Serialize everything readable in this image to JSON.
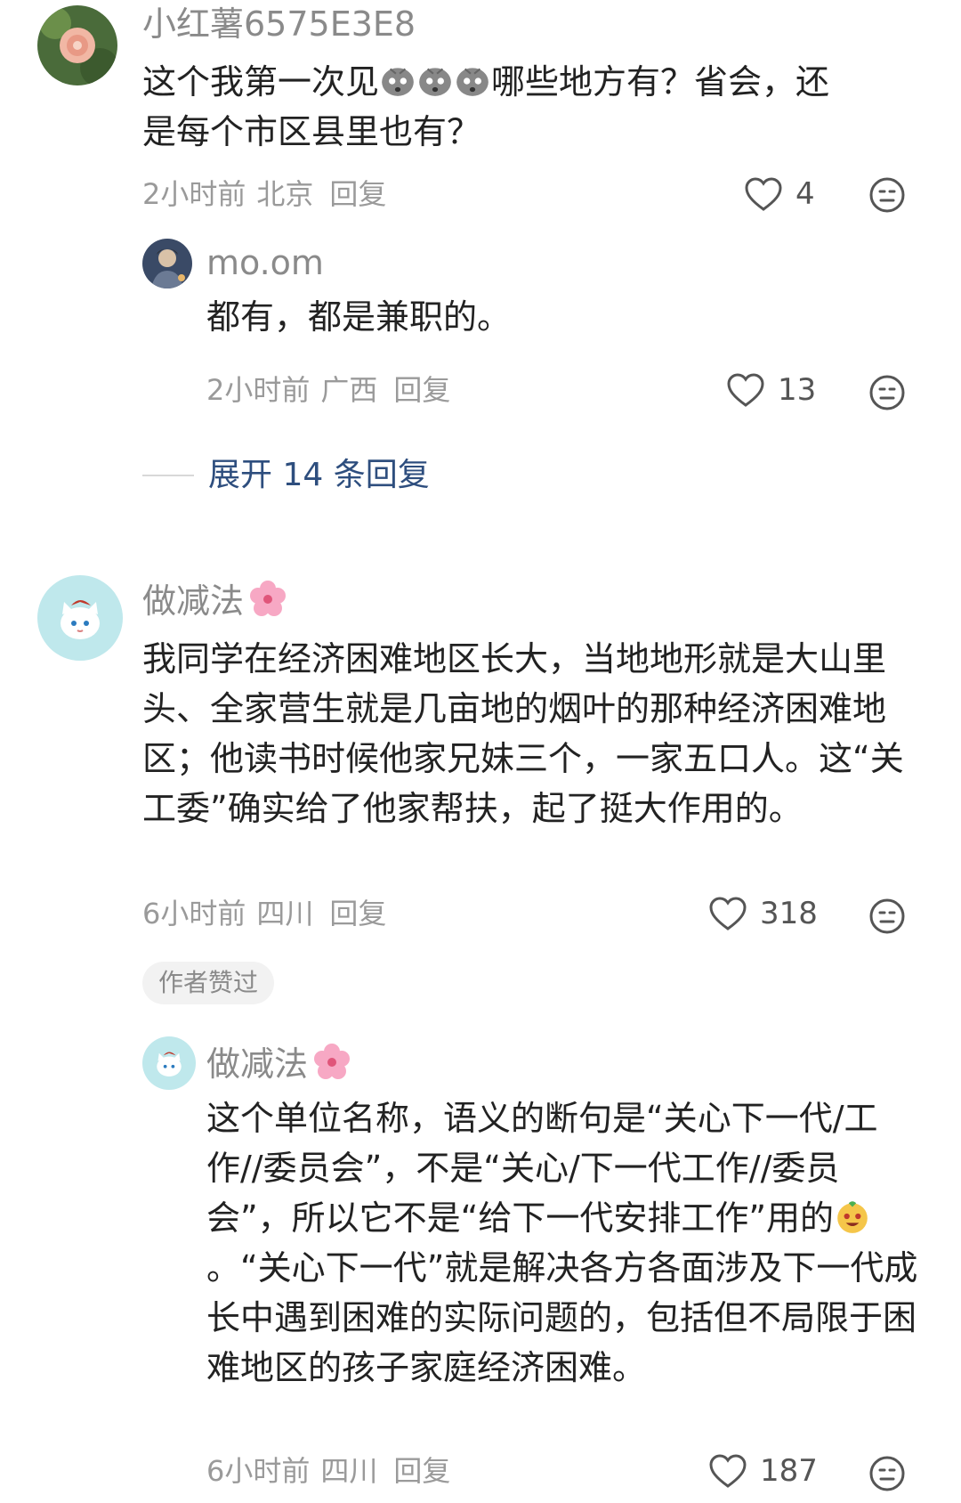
{
  "comments": [
    {
      "username": "小红薯6575E3E8",
      "content_before_emoji": "这个我第一次见",
      "content_after_emoji": "哪些地方有？省会，还是每个市区县里也有？",
      "time": "2小时前",
      "region": "北京",
      "reply_label": "回复",
      "likes": "4"
    },
    {
      "username": "mo.om",
      "content": "都有，都是兼职的。",
      "time": "2小时前",
      "region": "广西",
      "reply_label": "回复",
      "likes": "13"
    },
    {
      "username": "做减法",
      "content": "我同学在经济困难地区长大，当地地形就是大山里头、全家营生就是几亩地的烟叶的那种经济困难地区；他读书时候他家兄妹三个，一家五口人。这“关工委”确实给了他家帮扶，起了挺大作用的。",
      "time": "6小时前",
      "region": "四川",
      "reply_label": "回复",
      "likes": "318",
      "badge": "作者赞过"
    },
    {
      "username": "做减法",
      "content_before_emoji": "这个单位名称，语义的断句是“关心下一代/工作//委员会”，不是“关心/下一代工作//委员会”，所以它不是“给下一代安排工作”用的",
      "content_after_emoji": "。“关心下一代”就是解决各方各面涉及下一代成长中遇到困难的实际问题的，包括但不局限于困难地区的孩子家庭经济困难。",
      "time": "6小时前",
      "region": "四川",
      "reply_label": "回复",
      "likes": "187"
    }
  ],
  "expand_replies": "展开 14 条回复",
  "icons": {
    "like": "heart-outline-icon",
    "emoji": "emoji-face-icon",
    "flower": "cherry-blossom-icon"
  },
  "colors": {
    "username": "#8a8a8a",
    "content": "#222222",
    "meta": "#9a9a9a",
    "expand": "#2e4e7e",
    "badge_bg": "#f2f2f2"
  }
}
